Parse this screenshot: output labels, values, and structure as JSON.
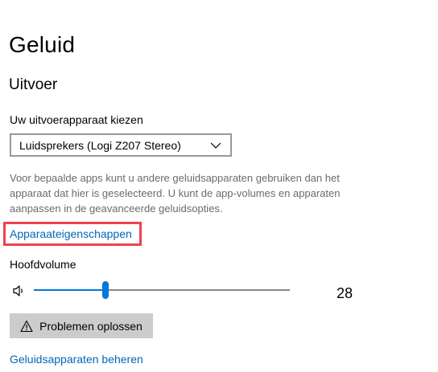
{
  "page": {
    "title": "Geluid"
  },
  "output": {
    "section_title": "Uitvoer",
    "device_label": "Uw uitvoerapparaat kiezen",
    "device_selected": "Luidsprekers (Logi Z207 Stereo)",
    "description": "Voor bepaalde apps kunt u andere geluidsapparaten gebruiken dan het apparaat dat hier is geselecteerd. U kunt de app-volumes en apparaten aanpassen in de geavanceerde geluidsopties.",
    "device_properties_link": "Apparaateigenschappen",
    "master_volume_label": "Hoofdvolume",
    "volume_value": "28",
    "volume_percent": 28,
    "troubleshoot_label": "Problemen oplossen",
    "manage_devices_link": "Geluidsapparaten beheren"
  },
  "icons": {
    "dropdown": "chevron-down-icon",
    "speaker": "speaker-icon",
    "troubleshoot": "warning-icon"
  },
  "colors": {
    "accent": "#0078d7",
    "link": "#0067b8",
    "highlight": "#ef4150",
    "button_bg": "#cccccc"
  }
}
